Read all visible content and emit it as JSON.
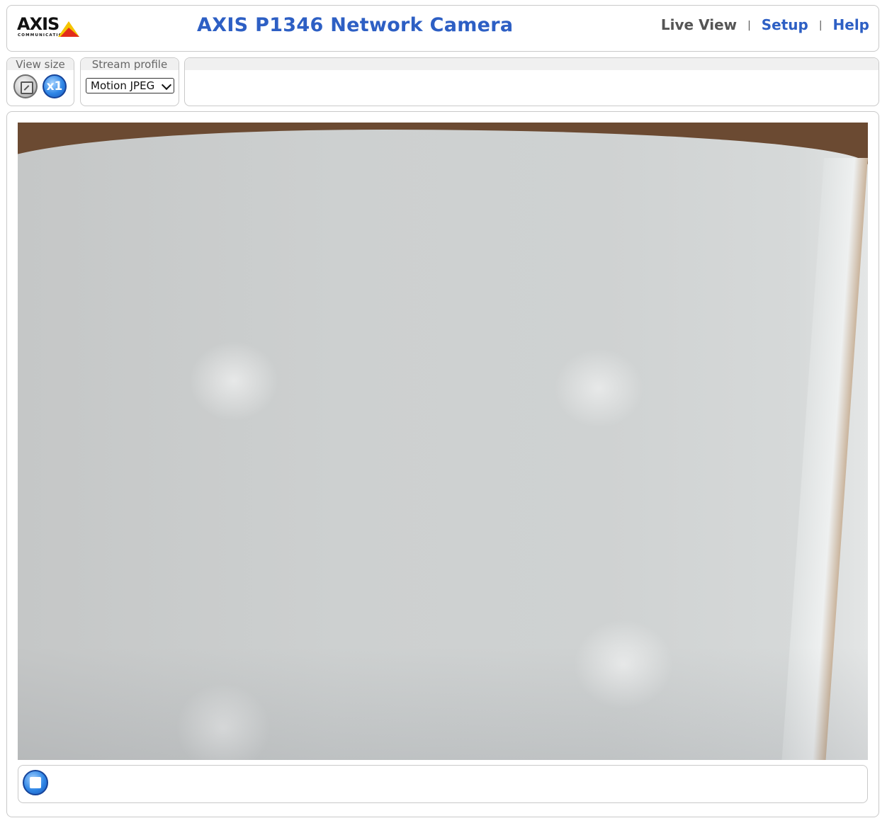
{
  "header": {
    "logo_text": "AXIS",
    "logo_subtext": "COMMUNICATIONS",
    "title": "AXIS P1346 Network Camera",
    "nav": {
      "live_view": "Live View",
      "setup": "Setup",
      "help": "Help",
      "separator": "|"
    }
  },
  "toolbar": {
    "view_size_label": "View size",
    "view_size_x1": "x1",
    "stream_profile_label": "Stream profile",
    "stream_profile_value": "Motion JPEG"
  },
  "colors": {
    "title_blue": "#2d5fc4",
    "nav_current": "#555555",
    "button_blue": "#2f86e6"
  },
  "icons": {
    "view_size_fit": "fit-to-window-icon",
    "view_size_actual": "x1-icon",
    "stop": "stop-icon",
    "stream_dropdown": "chevron-down-icon"
  }
}
